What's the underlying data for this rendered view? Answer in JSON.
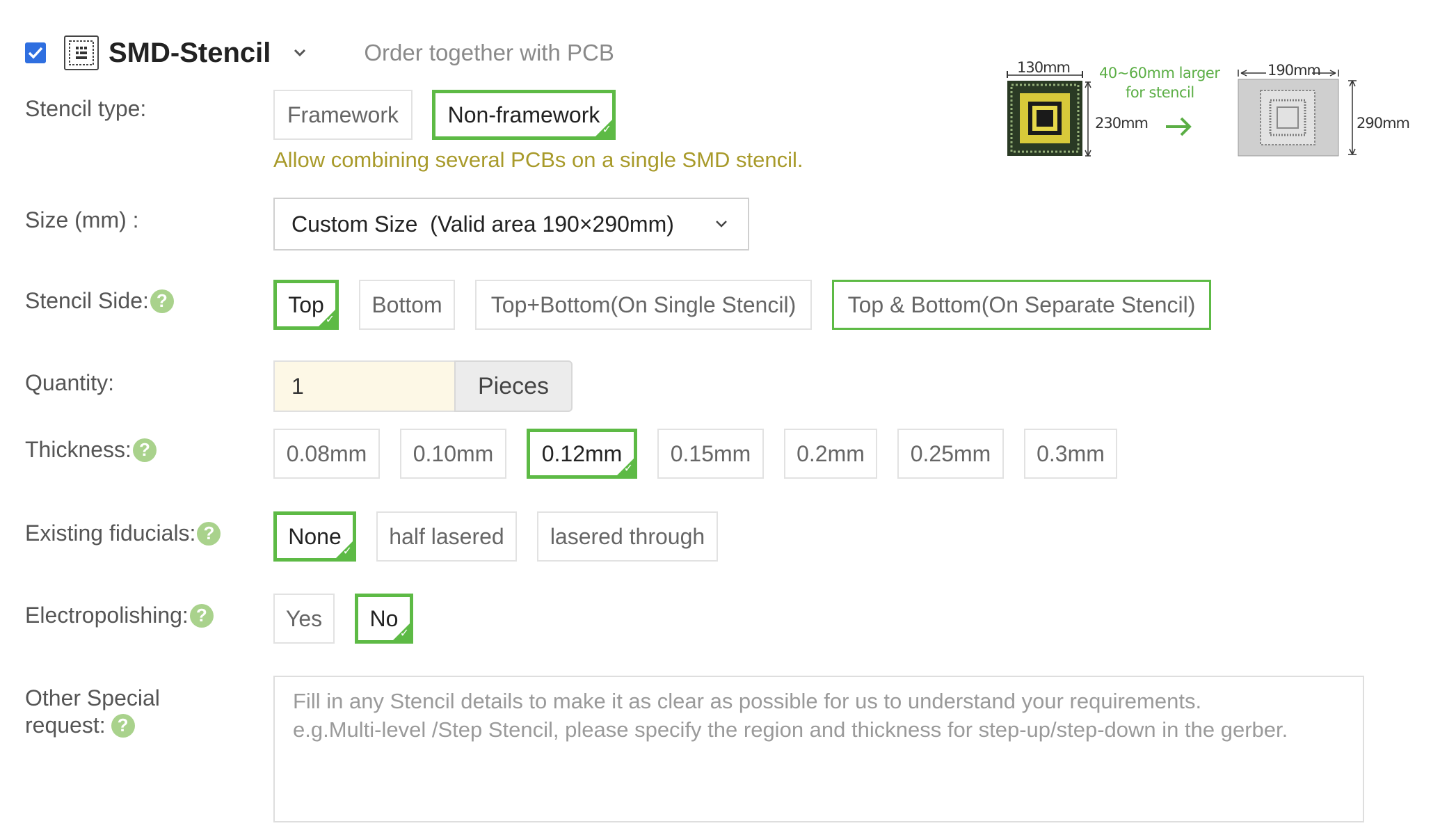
{
  "header": {
    "checked": true,
    "title": "SMD-Stencil",
    "subtitle": "Order together with PCB"
  },
  "stencil_type": {
    "label": "Stencil type:",
    "options": [
      "Framework",
      "Non-framework"
    ],
    "selected": "Non-framework",
    "note": "Allow combining several PCBs on a single SMD stencil."
  },
  "size": {
    "label": "Size (mm) :",
    "value": "Custom Size  (Valid area 190×290mm)"
  },
  "stencil_side": {
    "label": "Stencil Side:",
    "options": [
      "Top",
      "Bottom",
      "Top+Bottom(On Single Stencil)",
      "Top & Bottom(On Separate Stencil)"
    ],
    "selected": "Top"
  },
  "quantity": {
    "label": "Quantity:",
    "value": "1",
    "unit": "Pieces"
  },
  "thickness": {
    "label": "Thickness:",
    "options": [
      "0.08mm",
      "0.10mm",
      "0.12mm",
      "0.15mm",
      "0.2mm",
      "0.25mm",
      "0.3mm"
    ],
    "selected": "0.12mm"
  },
  "fiducials": {
    "label": "Existing fiducials:",
    "options": [
      "None",
      "half lasered",
      "lasered through"
    ],
    "selected": "None"
  },
  "electropolishing": {
    "label": "Electropolishing:",
    "options": [
      "Yes",
      "No"
    ],
    "selected": "No"
  },
  "other": {
    "label_line1": "Other Special",
    "label_line2": "request:",
    "placeholder": "Fill in any Stencil details to make it as clear as possible for us to understand your requirements.\ne.g.Multi-level /Step Stencil, please specify the region and thickness for step-up/step-down in the gerber."
  },
  "diagram": {
    "pcb_width": "130mm",
    "pcb_height": "230mm",
    "note_line1": "40~60mm larger",
    "note_line2": "for stencil",
    "stencil_width": "190mm",
    "stencil_height": "290mm"
  },
  "help_glyph": "?",
  "colors": {
    "accent_green": "#5dba45",
    "help_green": "#a9d28c",
    "checkbox_blue": "#2f6fe0",
    "note_olive": "#a89a2a"
  }
}
